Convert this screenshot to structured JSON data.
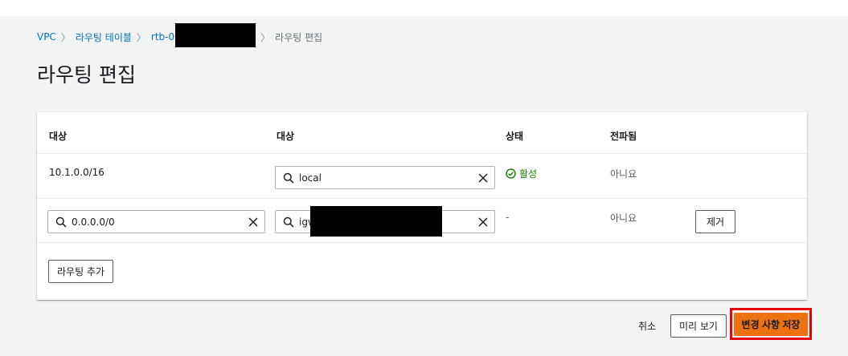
{
  "breadcrumb": {
    "items": [
      "VPC",
      "라우팅 테이블",
      "rtb-0"
    ],
    "current": "라우팅 편집",
    "separator": "〉"
  },
  "page": {
    "title": "라우팅 편집"
  },
  "table": {
    "columns": [
      "대상",
      "대상",
      "상태",
      "전파됨"
    ],
    "rows": [
      {
        "destination": "10.1.0.0/16",
        "target": "local",
        "status": "활성",
        "propagated": "아니요"
      },
      {
        "destination": "0.0.0.0/0",
        "target": "igw",
        "status": "-",
        "propagated": "아니요",
        "remove_label": "제거"
      }
    ],
    "add_route_label": "라우팅 추가"
  },
  "footer": {
    "cancel_label": "취소",
    "preview_label": "미리 보기",
    "save_label": "변경 사항 저장"
  },
  "colors": {
    "link": "#0073bb",
    "success": "#1d8102",
    "primary": "#ec7211",
    "highlight": "#e5000a"
  }
}
